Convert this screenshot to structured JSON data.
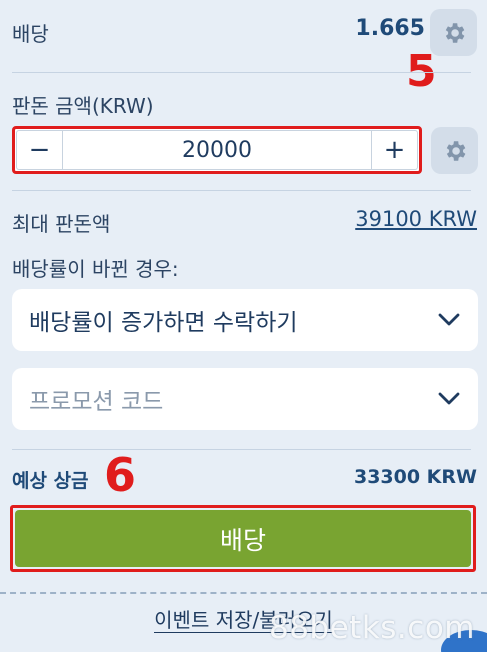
{
  "odds": {
    "label": "배당",
    "value": "1.665"
  },
  "annotations": {
    "first": "5",
    "second": "6"
  },
  "stake": {
    "label": "판돈 금액(KRW)",
    "value": "20000",
    "minus": "−",
    "plus": "+"
  },
  "max_stake": {
    "label": "최대 판돈액",
    "value": "39100 KRW"
  },
  "odds_change": {
    "label": "배당률이 바뀐 경우:",
    "selected": "배당률이 증가하면 수락하기"
  },
  "promo": {
    "placeholder": "프로모션 코드"
  },
  "payout": {
    "label": "예상 상금",
    "value": "33300 KRW"
  },
  "place_bet": {
    "label": "배당"
  },
  "save_link": {
    "label": "이벤트 저장/불러오기"
  },
  "watermark": "88betks.com",
  "colors": {
    "accent_green": "#79a431",
    "highlight_red": "#e01c1c",
    "text_navy": "#1f4a78",
    "background": "#e7eef6"
  },
  "icons": {
    "settings": "gear-icon",
    "dropdown": "chevron-down-icon"
  }
}
